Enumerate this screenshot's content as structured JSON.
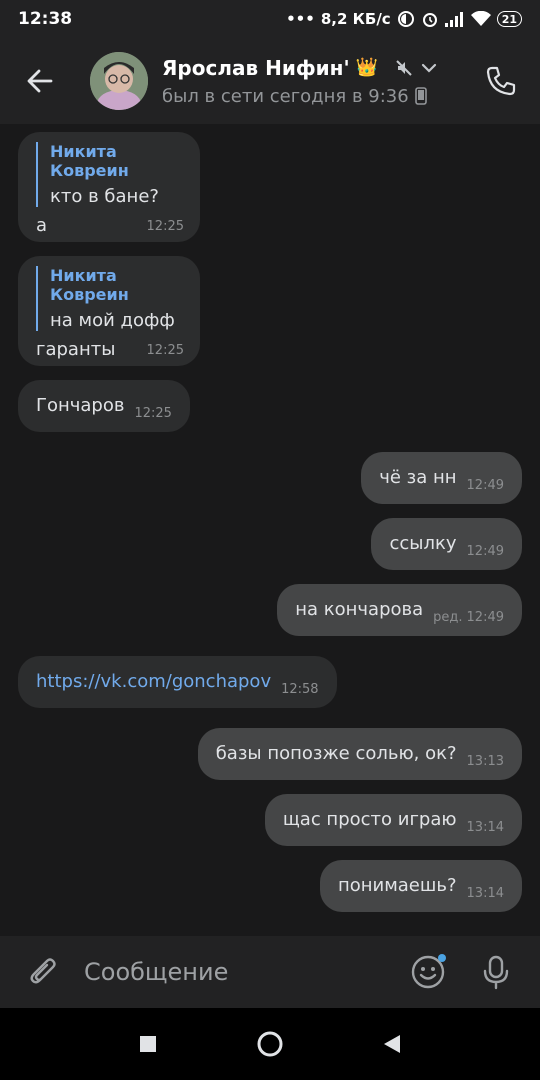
{
  "status_bar": {
    "time": "12:38",
    "network_speed": "8,2 КБ/с",
    "battery": "21"
  },
  "header": {
    "contact_name": "Ярослав Нифин'",
    "name_emoji": "👑",
    "last_seen": "был в сети сегодня в 9:36",
    "icons": [
      "back-arrow-icon",
      "muted-icon",
      "chevron-down-icon",
      "mobile-icon",
      "phone-icon"
    ]
  },
  "messages": [
    {
      "dir": "in",
      "reply_author": "Никита Ковреин",
      "reply_text": "кто в бане?",
      "text": "а",
      "time": "12:25"
    },
    {
      "dir": "in",
      "reply_author": "Никита Ковреин",
      "reply_text": "на мой дофф",
      "text": "гаранты",
      "time": "12:25"
    },
    {
      "dir": "in",
      "text": "Гончаров",
      "time": "12:25"
    },
    {
      "dir": "out",
      "text": "чё за нн",
      "time": "12:49"
    },
    {
      "dir": "out",
      "text": "ссылку",
      "time": "12:49"
    },
    {
      "dir": "out",
      "text": "на кончарова",
      "edited": "ред.",
      "time": "12:49"
    },
    {
      "dir": "in",
      "text": "https://vk.com/gonchapov",
      "time": "12:58",
      "is_link": true
    },
    {
      "dir": "out",
      "text": "базы попозже солью, ок?",
      "time": "13:13"
    },
    {
      "dir": "out",
      "text": "щас просто играю",
      "time": "13:14"
    },
    {
      "dir": "out",
      "text": "понимаешь?",
      "time": "13:14"
    }
  ],
  "composer": {
    "placeholder": "Сообщение",
    "icons": [
      "paperclip-icon",
      "emoji-icon",
      "microphone-icon"
    ]
  },
  "navbar": {
    "icons": [
      "recents-icon",
      "home-icon",
      "back-icon"
    ]
  },
  "colors": {
    "background": "#19191a",
    "header": "#222223",
    "incoming_bubble": "#2c2d2e",
    "outgoing_bubble": "#454647",
    "accent": "#71aaeb"
  }
}
